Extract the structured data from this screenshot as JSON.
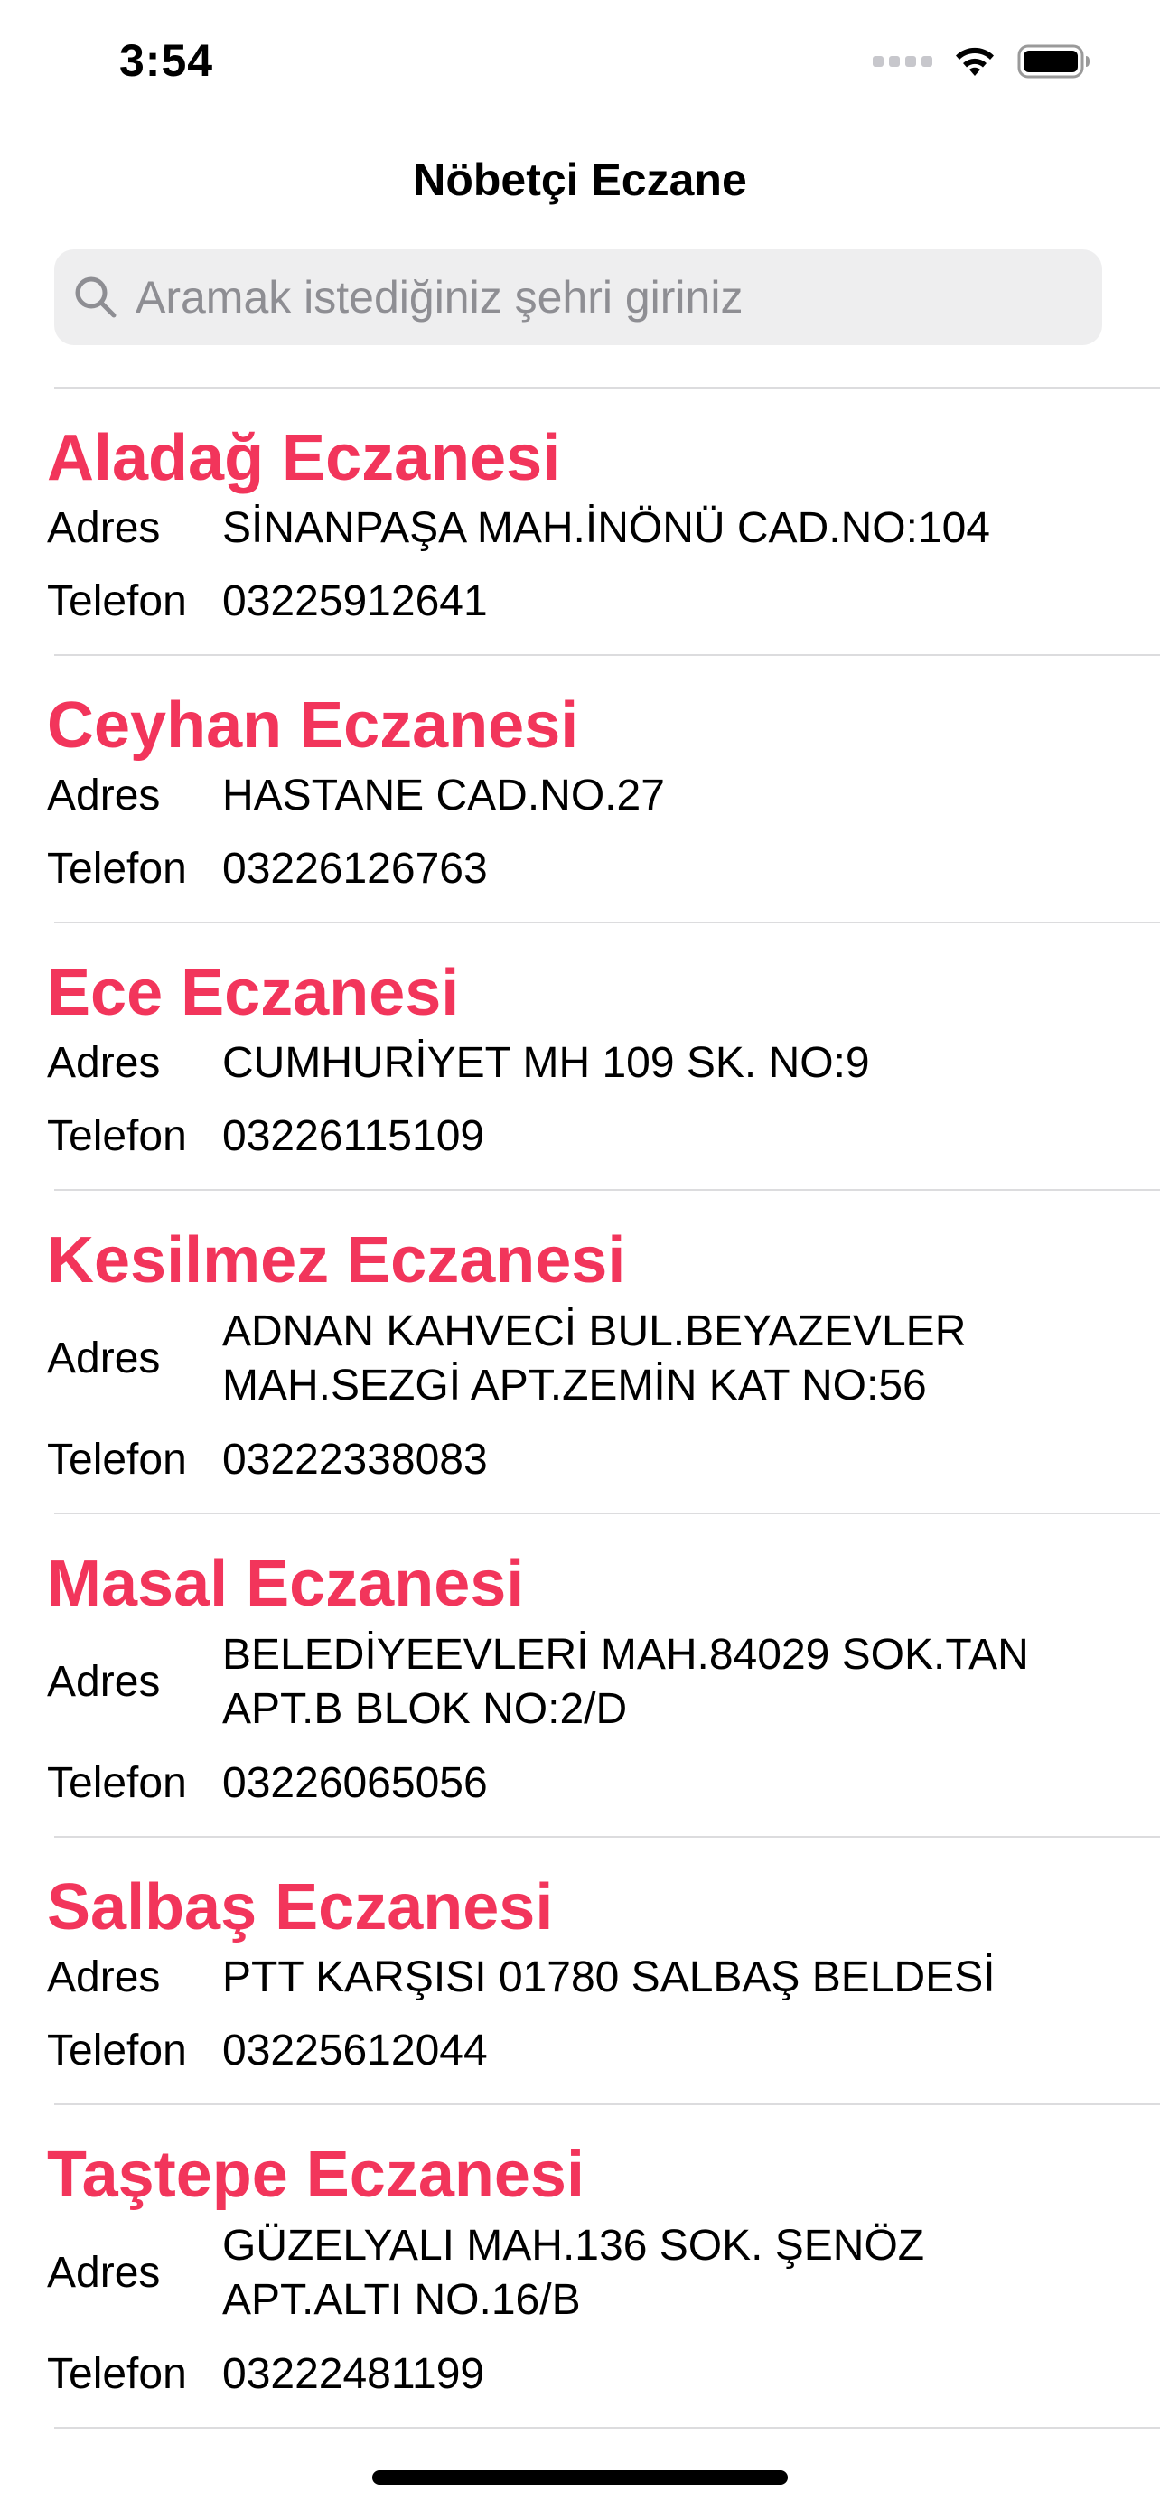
{
  "status_bar": {
    "time": "3:54"
  },
  "nav": {
    "title": "Nöbetçi Eczane"
  },
  "search": {
    "placeholder": "Aramak istediğiniz şehri giriniz",
    "value": ""
  },
  "labels": {
    "address": "Adres",
    "phone": "Telefon"
  },
  "pharmacies": [
    {
      "name": "Aladağ Eczanesi",
      "address": "SİNANPAŞA MAH.İNÖNÜ CAD.NO:104",
      "phone": "03225912641"
    },
    {
      "name": "Ceyhan Eczanesi",
      "address": "HASTANE CAD.NO.27",
      "phone": "03226126763"
    },
    {
      "name": "Ece Eczanesi",
      "address": "CUMHURİYET MH 109 SK. NO:9",
      "phone": "03226115109"
    },
    {
      "name": "Kesilmez Eczanesi",
      "address_lines": [
        "ADNAN KAHVECİ BUL.BEYAZEVLER",
        "MAH.SEZGİ APT.ZEMİN KAT NO:56"
      ],
      "phone": "03222338083"
    },
    {
      "name": "Masal Eczanesi",
      "address_lines": [
        "BELEDİYEEVLERİ MAH.84029 SOK.TAN",
        "APT.B BLOK NO:2/D"
      ],
      "phone": "03226065056"
    },
    {
      "name": "Salbaş Eczanesi",
      "address": "PTT KARŞISI 01780 SALBAŞ BELDESİ",
      "phone": "03225612044"
    },
    {
      "name": "Taştepe Eczanesi",
      "address_lines": [
        "GÜZELYALI MAH.136 SOK. ŞENÖZ",
        "APT.ALTI NO.16/B"
      ],
      "phone": "03222481199"
    }
  ],
  "colors": {
    "accent": "#f2355b",
    "search_bg": "#eeeeef",
    "placeholder": "#8e8e93",
    "divider": "#dcdcde"
  },
  "icons": {
    "search": "search-icon",
    "wifi": "wifi-icon",
    "battery": "battery-icon",
    "cellular": "cellular-signal-icon"
  }
}
